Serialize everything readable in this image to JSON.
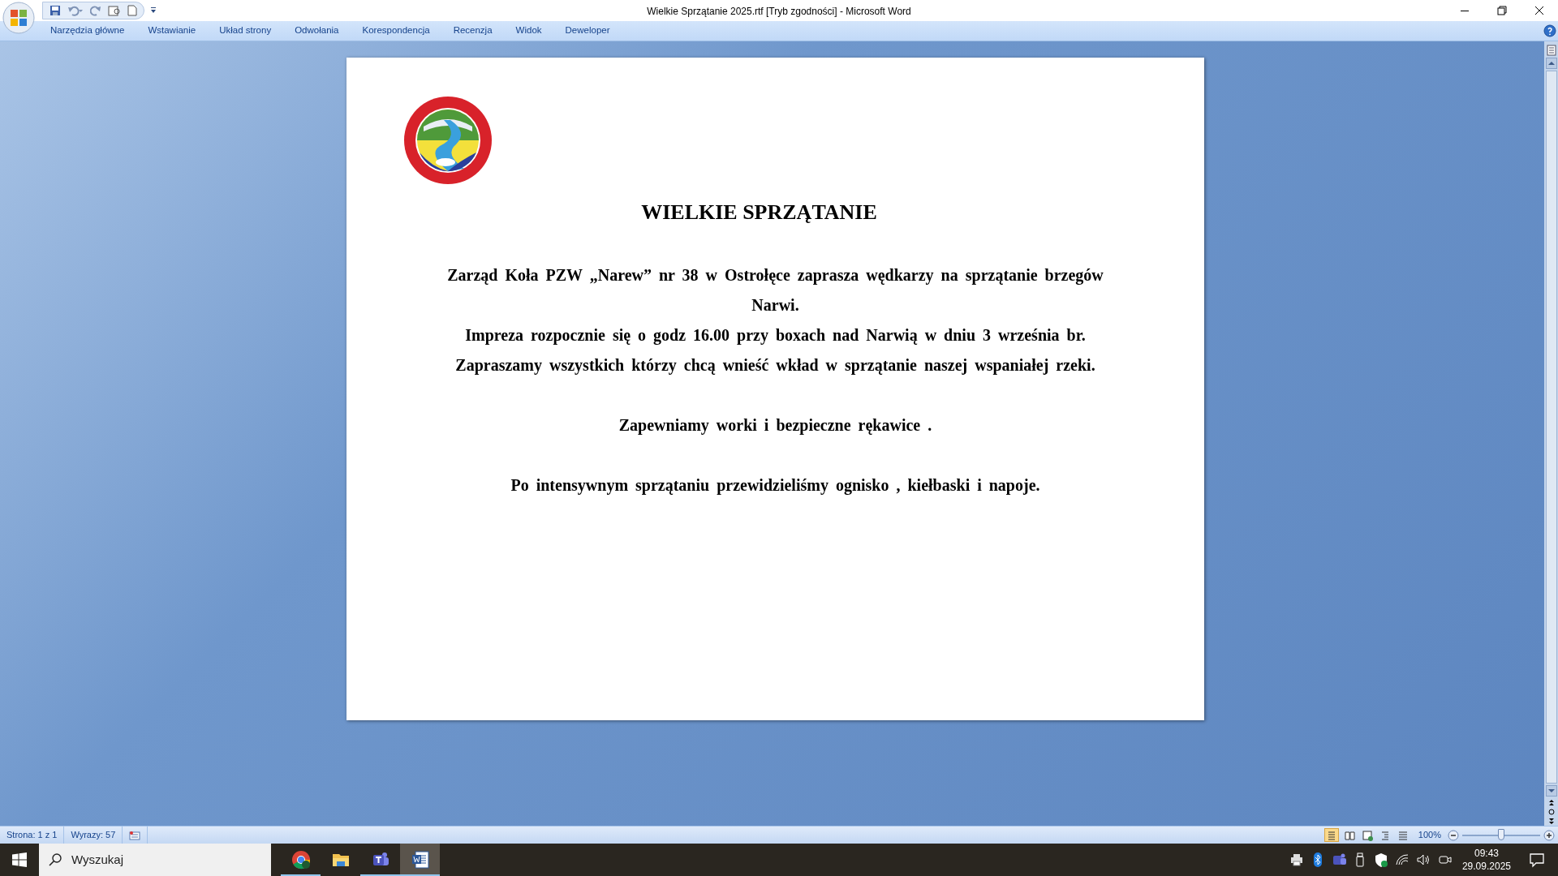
{
  "window": {
    "title": "Wielkie Sprzątanie 2025.rtf [Tryb zgodności] - Microsoft Word"
  },
  "ribbon_tabs": [
    {
      "label": "Narzędzia główne"
    },
    {
      "label": "Wstawianie"
    },
    {
      "label": "Układ strony"
    },
    {
      "label": "Odwołania"
    },
    {
      "label": "Korespondencja"
    },
    {
      "label": "Recenzja"
    },
    {
      "label": "Widok"
    },
    {
      "label": "Deweloper"
    }
  ],
  "document": {
    "logo": {
      "kind": "picture"
    },
    "heading": "WIELKIE SPRZĄTANIE",
    "blocks": [
      [
        "Zarząd Koła PZW „Narew” nr 38  w Ostrołęce zaprasza wędkarzy na sprzątanie brzegów Narwi.",
        "Impreza rozpocznie się o godz 16.00 przy boxach nad Narwią w dniu 3 września br.",
        "Zapraszamy wszystkich którzy chcą wnieść wkład w sprzątanie naszej wspaniałej rzeki."
      ],
      [
        "Zapewniamy worki i bezpieczne rękawice ."
      ],
      [
        "Po intensywnym sprzątaniu przewidzieliśmy ognisko , kiełbaski i napoje."
      ]
    ]
  },
  "status_bar": {
    "page": "Strona: 1 z 1",
    "words": "Wyrazy: 57",
    "view_buttons": [
      {
        "selected": true
      },
      {
        "selected": false
      },
      {
        "selected": false
      },
      {
        "selected": false
      },
      {
        "selected": false
      }
    ],
    "zoom": "100%",
    "zoom_slider": {
      "level": 0.5
    }
  },
  "taskbar": {
    "search": {
      "placeholder": "Wyszukaj"
    },
    "apps": [
      {
        "kind": "chrome",
        "running": true,
        "selected": false
      },
      {
        "kind": "folder",
        "running": false,
        "selected": false
      },
      {
        "kind": "teams",
        "running": true,
        "selected": false
      },
      {
        "kind": "word",
        "running": true,
        "selected": true
      }
    ],
    "clock": {
      "time": "09:43",
      "date": "29.09.2025"
    }
  }
}
